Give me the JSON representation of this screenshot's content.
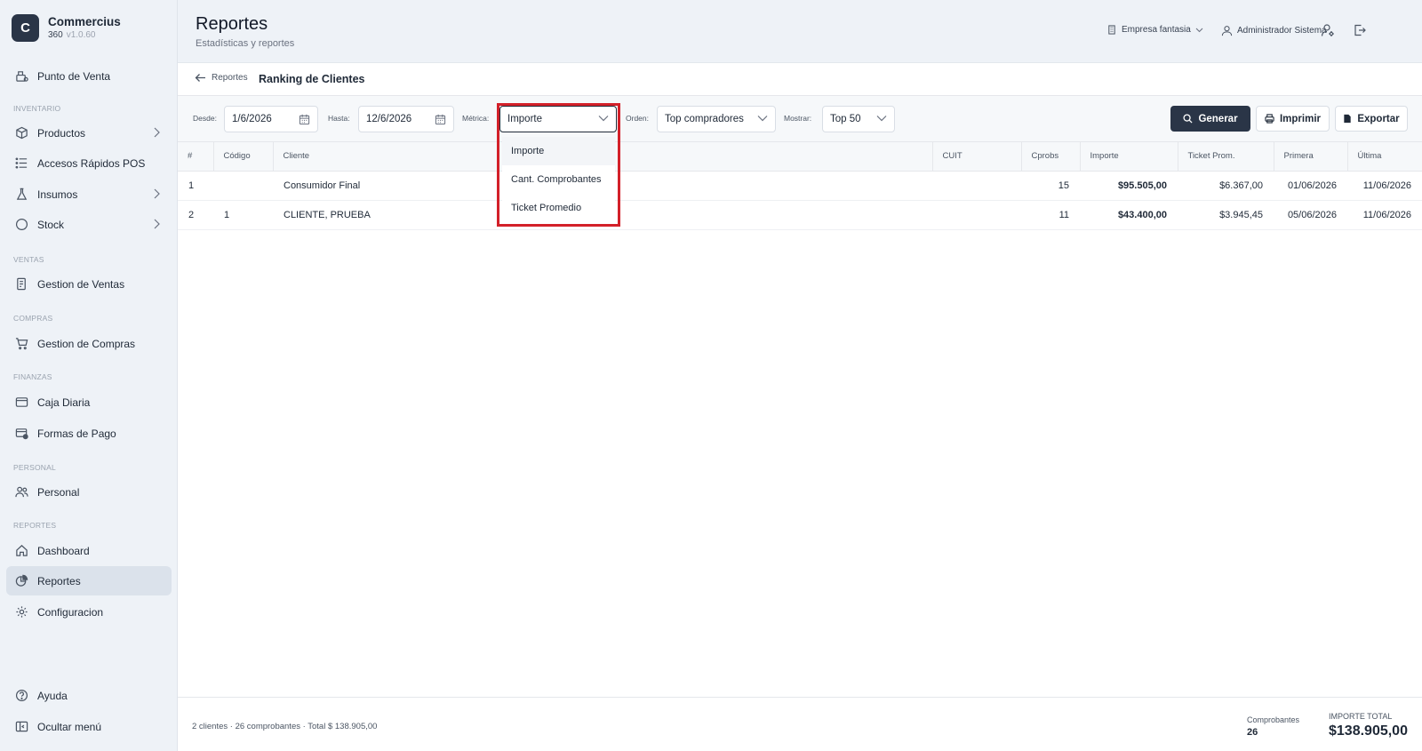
{
  "brand": {
    "logo_letter": "C",
    "name": "Commercius",
    "sub": "360",
    "version": "v1.0.60"
  },
  "sidebar": {
    "top_item": "Punto de Venta",
    "sections": {
      "inventario": "INVENTARIO",
      "ventas": "VENTAS",
      "compras": "COMPRAS",
      "finanzas": "FINANZAS",
      "personal": "PERSONAL",
      "reportes": "REPORTES"
    },
    "items": {
      "productos": "Productos",
      "accesos": "Accesos Rápidos POS",
      "insumos": "Insumos",
      "stock": "Stock",
      "gestion_ventas": "Gestion de Ventas",
      "gestion_compras": "Gestion de Compras",
      "caja": "Caja Diaria",
      "formas_pago": "Formas de Pago",
      "personal": "Personal",
      "dashboard": "Dashboard",
      "reportes": "Reportes",
      "configuracion": "Configuracion"
    },
    "bottom": {
      "ayuda": "Ayuda",
      "ocultar": "Ocultar menú"
    },
    "active_item": "Reportes"
  },
  "header": {
    "title": "Reportes",
    "subtitle": "Estadísticas y reportes",
    "company": "Empresa fantasia",
    "user": "Administrador Sistema"
  },
  "breadcrumb": {
    "back_label": "Reportes",
    "title": "Ranking de Clientes"
  },
  "filters": {
    "desde_label": "Desde:",
    "desde_value": "1/6/2026",
    "hasta_label": "Hasta:",
    "hasta_value": "12/6/2026",
    "metrica_label": "Métrica:",
    "metrica_value": "Importe",
    "orden_label": "Orden:",
    "orden_value": "Top compradores",
    "mostrar_label": "Mostrar:",
    "mostrar_value": "Top 50"
  },
  "buttons": {
    "generar": "Generar",
    "imprimir": "Imprimir",
    "exportar": "Exportar"
  },
  "metrica_menu": {
    "options": [
      "Importe",
      "Cant. Comprobantes",
      "Ticket Promedio"
    ],
    "selected": "Importe"
  },
  "table": {
    "headers": [
      "#",
      "Código",
      "Cliente",
      "CUIT",
      "Cprobs",
      "Importe",
      "Ticket Prom.",
      "Primera",
      "Última"
    ],
    "rows": [
      {
        "rank": "1",
        "codigo": "",
        "cliente": "Consumidor Final",
        "cuit": "",
        "cprobs": "15",
        "importe": "$95.505,00",
        "ticket": "$6.367,00",
        "primera": "01/06/2026",
        "ultima": "11/06/2026"
      },
      {
        "rank": "2",
        "codigo": "1",
        "cliente": "CLIENTE, PRUEBA",
        "cuit": "",
        "cprobs": "11",
        "importe": "$43.400,00",
        "ticket": "$3.945,45",
        "primera": "05/06/2026",
        "ultima": "11/06/2026"
      }
    ]
  },
  "footer": {
    "summary": "2 clientes · 26 comprobantes · Total $ 138.905,00",
    "comprobantes_label": "Comprobantes",
    "comprobantes_value": "26",
    "importe_label": "IMPORTE TOTAL",
    "importe_value": "$138.905,00"
  },
  "colors": {
    "sidebar_bg": "#eef2f7",
    "primary": "#2a3547",
    "highlight": "#d32029"
  }
}
